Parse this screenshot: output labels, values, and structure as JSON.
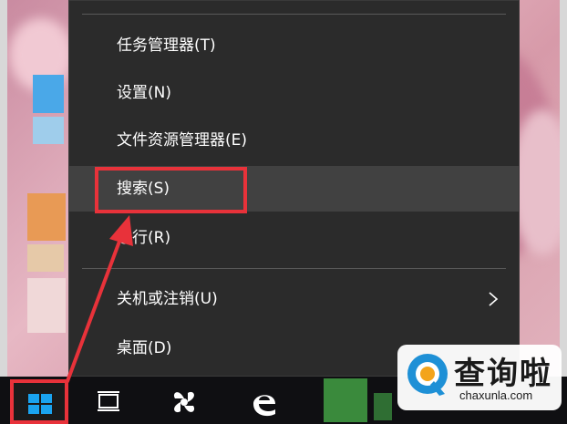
{
  "context_menu": {
    "items": [
      {
        "label": "任务管理器(T)"
      },
      {
        "label": "设置(N)"
      },
      {
        "label": "文件资源管理器(E)"
      },
      {
        "label": "搜索(S)"
      },
      {
        "label": "运行(R)"
      },
      {
        "label": "关机或注销(U)"
      },
      {
        "label": "桌面(D)"
      }
    ]
  },
  "watermark": {
    "title": "查询啦",
    "subtitle": "chaxunla.com"
  },
  "colors": {
    "menu_bg": "#2b2b2b",
    "menu_hover": "#414141",
    "highlight": "#e8323a",
    "start_blue": "#1aa3ef",
    "watermark_accent": "#1e90d6"
  },
  "taskbar": {
    "icons": [
      "start-icon",
      "task-view-icon",
      "fan-app-icon",
      "edge-icon",
      "app-icon-green",
      "app-icon-green-2"
    ]
  }
}
